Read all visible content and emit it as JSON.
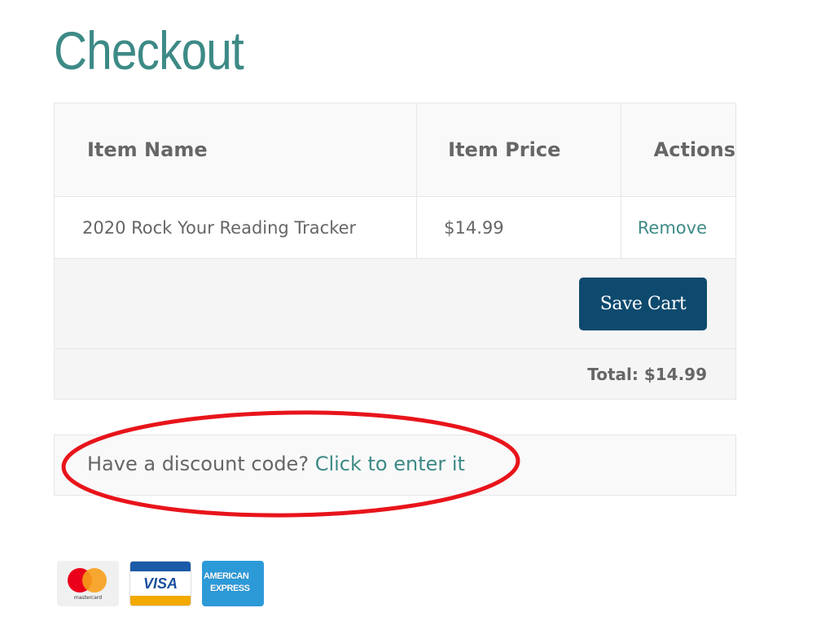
{
  "page": {
    "title": "Checkout"
  },
  "cart": {
    "columns": {
      "name": "Item Name",
      "price": "Item Price",
      "actions": "Actions"
    },
    "items": [
      {
        "name": "2020 Rock Your Reading Tracker",
        "price": "$14.99",
        "action_label": "Remove"
      }
    ],
    "save_cart_label": "Save Cart",
    "total_label": "Total: $14.99"
  },
  "discount": {
    "prompt": "Have a discount code?",
    "link_label": "Click to enter it"
  },
  "annotation": {
    "color": "#e8141b",
    "shape": "ellipse"
  },
  "payment_methods": [
    {
      "name": "mastercard",
      "label": "mastercard"
    },
    {
      "name": "visa",
      "label": "VISA"
    },
    {
      "name": "american-express",
      "label_line1": "AMERICAN",
      "label_line2": "EXPRESS"
    }
  ],
  "colors": {
    "accent": "#3d8a86",
    "button": "#0e4a6e",
    "text": "#666666"
  }
}
